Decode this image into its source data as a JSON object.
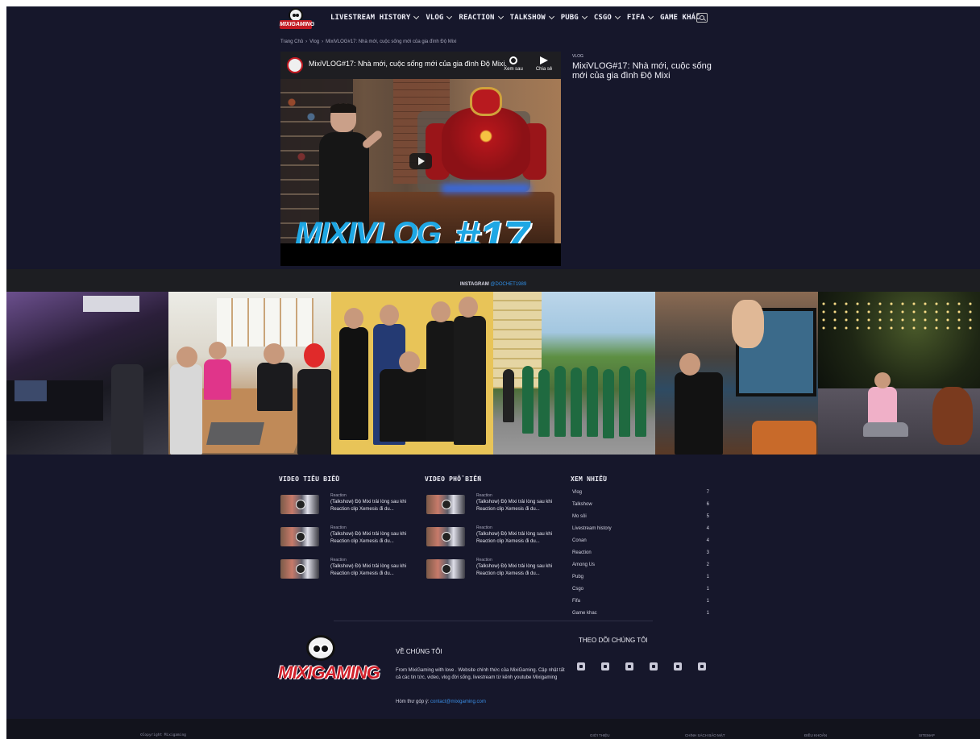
{
  "nav": {
    "items": [
      "LIVESTREAM HISTORY",
      "VLOG",
      "REACTION",
      "TALKSHOW",
      "PUBG",
      "CSGO",
      "FIFA",
      "GAME KHÁC"
    ],
    "has_dropdown": [
      true,
      true,
      true,
      true,
      true,
      true,
      true,
      false
    ]
  },
  "breadcrumb": {
    "home": "Trang Chủ",
    "sep": "›",
    "category": "Vlog",
    "current": "MixiVLOG#17: Nhà mới, cuộc sống mới của gia đình Độ Mixi"
  },
  "video": {
    "title": "MixiVLOG#17: Nhà mới, cuộc sống mới của gia đình Độ Mixi.",
    "watch_later": "Xem sau",
    "share": "Chia sẻ",
    "overlay_word": "MIXIVLOG",
    "overlay_num": "#17"
  },
  "post": {
    "category": "VLOG",
    "title": "MixiVLOG#17: Nhà mới, cuộc sống mới của gia đình Độ Mixi"
  },
  "instagram": {
    "label": "INSTAGRAM",
    "handle": "@DOCHET1989"
  },
  "featured": {
    "title": "VIDEO TIÊU BIỂU",
    "items": [
      {
        "cat": "Reaction",
        "title": "(Talkshow) Độ Mixi trải lòng sau khi Reaction clip Xemesis đi du..."
      },
      {
        "cat": "Reaction",
        "title": "(Talkshow) Độ Mixi trải lòng sau khi Reaction clip Xemesis đi du..."
      },
      {
        "cat": "Reaction",
        "title": "(Talkshow) Độ Mixi trải lòng sau khi Reaction clip Xemesis đi du..."
      }
    ]
  },
  "popular": {
    "title": "VIDEO PHỔ BIẾN",
    "items": [
      {
        "cat": "Reaction",
        "title": "(Talkshow) Độ Mixi trải lòng sau khi Reaction clip Xemesis đi du..."
      },
      {
        "cat": "Reaction",
        "title": "(Talkshow) Độ Mixi trải lòng sau khi Reaction clip Xemesis đi du..."
      },
      {
        "cat": "Reaction",
        "title": "(Talkshow) Độ Mixi trải lòng sau khi Reaction clip Xemesis đi du..."
      }
    ]
  },
  "most_viewed": {
    "title": "XEM NHIỀU",
    "items": [
      {
        "name": "Vlog",
        "count": "7"
      },
      {
        "name": "Talkshow",
        "count": "6"
      },
      {
        "name": "Mo sôi",
        "count": "5"
      },
      {
        "name": "Livestream history",
        "count": "4"
      },
      {
        "name": "Conan",
        "count": "4"
      },
      {
        "name": "Reaction",
        "count": "3"
      },
      {
        "name": "Among Us",
        "count": "2"
      },
      {
        "name": "Pubg",
        "count": "1"
      },
      {
        "name": "Csgo",
        "count": "1"
      },
      {
        "name": "Fifa",
        "count": "1"
      },
      {
        "name": "Game khac",
        "count": "1"
      }
    ]
  },
  "about": {
    "logo_text": "MIXIGAMING",
    "title": "VỀ CHÚNG TÔI",
    "text": "From MixiGaming with love . Website chính thức của MixiGaming. Cập nhật tất cả các tin tức, video, vlog đời sống, livestream từ kênh youtube Mixigaming",
    "mail_label": "Hòm thư góp ý:",
    "email": "contact@mixigaming.com"
  },
  "follow": {
    "title": "THEO DÕI CHÚNG TÔI",
    "icons": [
      "website-icon",
      "facebook-icon",
      "twitter-icon",
      "discord-icon",
      "instagram-icon",
      "youtube-icon"
    ]
  },
  "footer": {
    "copyright": "©Copyright Mixigaming",
    "links": [
      "GIỚI THIỆU",
      "CHÍNH SÁCH BẢO MẬT",
      "ĐIỀU KHOẢN",
      "SITEMAP"
    ]
  },
  "header": {
    "logo_text": "MIXIGAMING"
  },
  "colors": {
    "page_bg": "#16172b",
    "accent_link": "#2f8ee6",
    "brand_red": "#c21a22"
  }
}
